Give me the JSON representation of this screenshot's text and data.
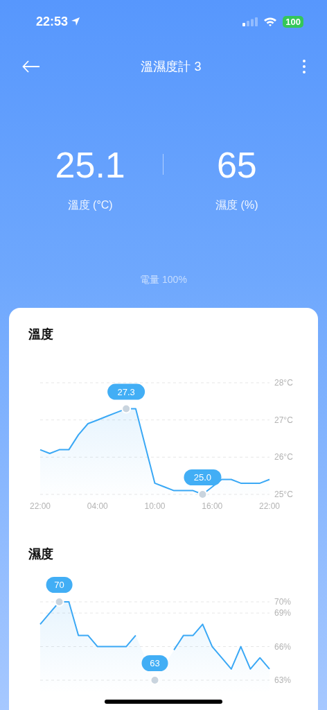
{
  "status_bar": {
    "time": "22:53",
    "battery": "100"
  },
  "header": {
    "title": "溫濕度計 3"
  },
  "readings": [
    {
      "value": "25.1",
      "label": "溫度 (°C)"
    },
    {
      "value": "65",
      "label": "濕度 (%)"
    }
  ],
  "battery_text": "電量 100%",
  "charts": [
    {
      "chart_data": {
        "type": "area",
        "title": "溫度",
        "grid": true,
        "categories": [
          "22:00",
          null,
          null,
          null,
          null,
          null,
          "04:00",
          null,
          null,
          null,
          null,
          null,
          "10:00",
          null,
          null,
          null,
          null,
          null,
          "16:00",
          null,
          null,
          null,
          null,
          null,
          "22:00"
        ],
        "series": [
          {
            "color": "#3aa8f5",
            "values": [
              26.2,
              26.1,
              26.2,
              26.2,
              26.6,
              26.9,
              27.0,
              27.1,
              27.2,
              27.3,
              27.3,
              26.3,
              25.3,
              25.2,
              25.1,
              25.1,
              25.1,
              25.0,
              25.2,
              25.4,
              25.4,
              25.3,
              25.3,
              25.3,
              25.4
            ]
          }
        ],
        "ylim": [
          25,
          28
        ],
        "yticks": [
          {
            "value": 25,
            "label": "25°C"
          },
          {
            "value": 26,
            "label": "26°C"
          },
          {
            "value": 27,
            "label": "27°C"
          },
          {
            "value": 28,
            "label": "28°C"
          }
        ],
        "annotations": [
          {
            "y": 27.3,
            "text": "27.3"
          },
          {
            "y": 25.0,
            "text": "25.0"
          }
        ]
      }
    },
    {
      "chart_data": {
        "type": "area",
        "title": "濕度",
        "grid": true,
        "categories": [
          null,
          null,
          null,
          null,
          null,
          null,
          null,
          null,
          null,
          null,
          null,
          null,
          null,
          null,
          null,
          null,
          null,
          null,
          null,
          null,
          null,
          null,
          null,
          null,
          null
        ],
        "series": [
          {
            "color": "#3aa8f5",
            "values": [
              68,
              69,
              70,
              70,
              67,
              67,
              66,
              66,
              66,
              66,
              67,
              null,
              63,
              null,
              65.7,
              67,
              67,
              68,
              66,
              65,
              64,
              66,
              64,
              65,
              64
            ]
          }
        ],
        "ylim": [
          63,
          70
        ],
        "yticks": [
          {
            "value": 63,
            "label": "63%"
          },
          {
            "value": 66,
            "label": "66%"
          },
          {
            "value": 69,
            "label": "69%"
          },
          {
            "value": 70,
            "label": "70%"
          }
        ],
        "annotations": [
          {
            "y": 70,
            "text": "70"
          },
          {
            "y": 63,
            "text": "63"
          }
        ]
      }
    }
  ]
}
